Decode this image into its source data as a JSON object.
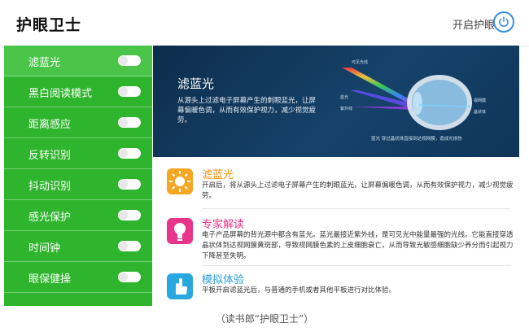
{
  "header": {
    "title": "护眼卫士",
    "power_label": "开启护眼"
  },
  "sidebar": {
    "items": [
      {
        "label": "滤蓝光"
      },
      {
        "label": "黑白阅读模式"
      },
      {
        "label": "距离感应"
      },
      {
        "label": "反转识别"
      },
      {
        "label": "抖动识别"
      },
      {
        "label": "感光保护"
      },
      {
        "label": "时间钟"
      },
      {
        "label": "眼保健操"
      }
    ]
  },
  "banner": {
    "title": "滤蓝光",
    "desc": "从源头上过滤电子屏幕产生的刺眼蓝光，让屏幕偏暖色调，从而有效保护视力，减少视觉疲劳。",
    "caption": "蓝光 穿过晶状体直接到达视网膜，造成光损伤",
    "diagram_labels": [
      "可见光线",
      "蓝光",
      "紫外线",
      "视网膜",
      "晶状体"
    ]
  },
  "features": [
    {
      "title": "滤蓝光",
      "desc": "开启后，将从源头上过滤电子屏幕产生的刺眼蓝光，让屏幕偏暖色调，从而有效保护视力，减少视觉疲劳。",
      "color": "#f5a623",
      "title_color": "#f08c00"
    },
    {
      "title": "专家解读",
      "desc": "电子产品屏幕的背光源中都含有蓝光。蓝光最接近紫外线，是可见光中能量最强的光线。它能直接穿透晶状体到达视网膜黄斑部，导致视网膜色素的上皮细胞衰亡，从而导致光敏感细胞缺少养分而引起视力下降甚至失明。",
      "color": "#e8348a",
      "title_color": "#e8348a"
    },
    {
      "title": "模拟体验",
      "desc": "平板开启滤蓝光后，与普通的手机或者其他平板进行对比体验。",
      "color": "#29a8e0",
      "title_color": "#2a9fd8"
    }
  ],
  "caption": "（读书郎“护眼卫士”）",
  "colors": {
    "sidebar": "#2fb52d",
    "accent": "#3b8fd6"
  }
}
